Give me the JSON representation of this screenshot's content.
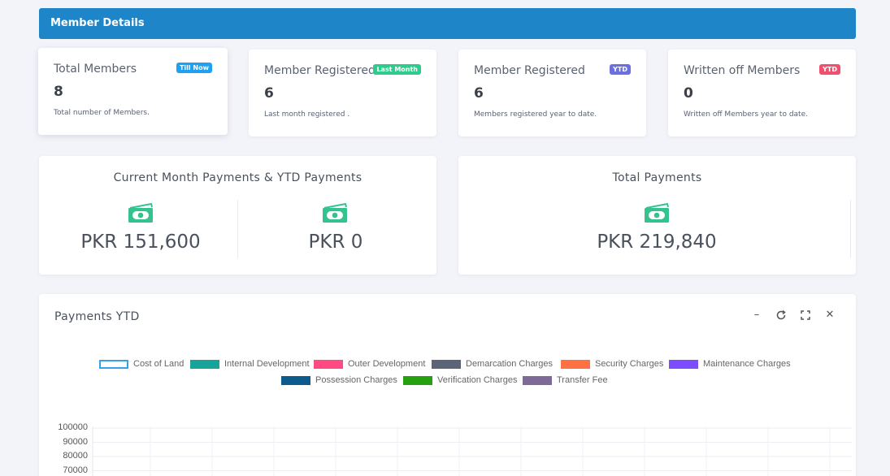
{
  "header": {
    "title": "Member Details"
  },
  "stats": [
    {
      "title": "Total Members",
      "badge": "Till Now",
      "badge_color": "#1ea1f2",
      "value": "8",
      "desc": "Total number of Members."
    },
    {
      "title": "Member Registered",
      "badge": "Last Month",
      "badge_color": "#2ecc8c",
      "value": "6",
      "desc": "Last month registered ."
    },
    {
      "title": "Member Registered",
      "badge": "YTD",
      "badge_color": "#6c6fe0",
      "value": "6",
      "desc": "Members registered year to date."
    },
    {
      "title": "Written off Members",
      "badge": "YTD",
      "badge_color": "#f0506e",
      "value": "0",
      "desc": "Written off Members year to date."
    }
  ],
  "payments": {
    "current": {
      "title": "Current Month Payments & YTD Payments",
      "month_amount": "PKR 151,600",
      "ytd_amount": "PKR 0"
    },
    "total": {
      "title": "Total Payments",
      "amount": "PKR 219,840"
    },
    "icon": "money-bill-icon",
    "icon_color": "#34c38f"
  },
  "chart_panel": {
    "title": "Payments YTD",
    "controls": [
      "minimize-icon",
      "refresh-icon",
      "fullscreen-icon",
      "close-icon"
    ]
  },
  "chart_data": {
    "type": "bar",
    "series": [
      {
        "name": "Cost of Land",
        "color": "#ffffff",
        "border": "#36a2eb"
      },
      {
        "name": "Internal Development",
        "color": "#17a59a"
      },
      {
        "name": "Outer Development",
        "color": "#ff4a82"
      },
      {
        "name": "Demarcation Charges",
        "color": "#5b6577"
      },
      {
        "name": "Security Charges",
        "color": "#ff7043"
      },
      {
        "name": "Maintenance Charges",
        "color": "#7c4dff"
      },
      {
        "name": "Possession Charges",
        "color": "#0d5b8c"
      },
      {
        "name": "Verification Charges",
        "color": "#27a010"
      },
      {
        "name": "Transfer Fee",
        "color": "#7e6a96"
      }
    ],
    "y_ticks": [
      "100000",
      "90000",
      "80000",
      "70000"
    ],
    "ylim": [
      0,
      100000
    ],
    "grid": true,
    "legend": "top-center"
  }
}
